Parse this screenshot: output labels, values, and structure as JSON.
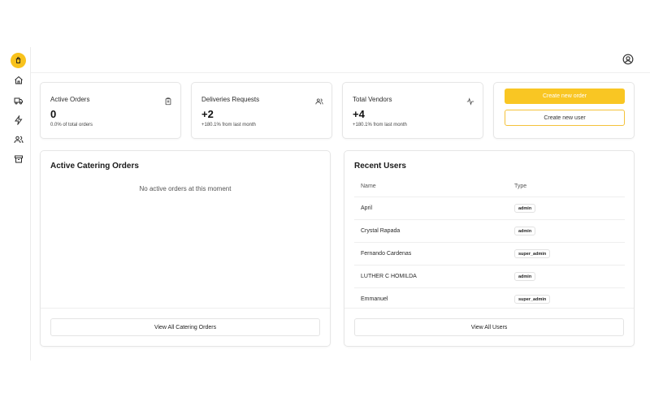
{
  "sidebar": {
    "items": [
      {
        "icon": "shopping-bag-icon"
      },
      {
        "icon": "home-icon"
      },
      {
        "icon": "truck-icon"
      },
      {
        "icon": "lightning-icon"
      },
      {
        "icon": "users-icon"
      },
      {
        "icon": "archive-icon"
      }
    ]
  },
  "header": {
    "user_icon": "user-circle-icon"
  },
  "stats": [
    {
      "title": "Active Orders",
      "value": "0",
      "sub": "0.0% of total orders",
      "icon": "clipboard-icon"
    },
    {
      "title": "Deliveries Requests",
      "value": "+2",
      "sub": "+180.1% from last month",
      "icon": "users-icon"
    },
    {
      "title": "Total Vendors",
      "value": "+4",
      "sub": "+180.1% from last month",
      "icon": "activity-icon"
    }
  ],
  "actions": {
    "create_order": "Create new order",
    "create_user": "Create new user"
  },
  "catering": {
    "title": "Active Catering Orders",
    "empty": "No active orders at this moment",
    "view_all": "View All Catering Orders"
  },
  "recent_users": {
    "title": "Recent Users",
    "columns": [
      "Name",
      "Type"
    ],
    "rows": [
      {
        "name": "April",
        "type": "admin"
      },
      {
        "name": "Crystal Rapada",
        "type": "admin"
      },
      {
        "name": "Fernando Cardenas",
        "type": "super_admin"
      },
      {
        "name": "LUTHER C HOMILDA",
        "type": "admin"
      },
      {
        "name": "Emmanuel",
        "type": "super_admin"
      }
    ],
    "view_all": "View All Users"
  },
  "colors": {
    "accent": "#f9c623",
    "border": "#e6e6e6"
  }
}
